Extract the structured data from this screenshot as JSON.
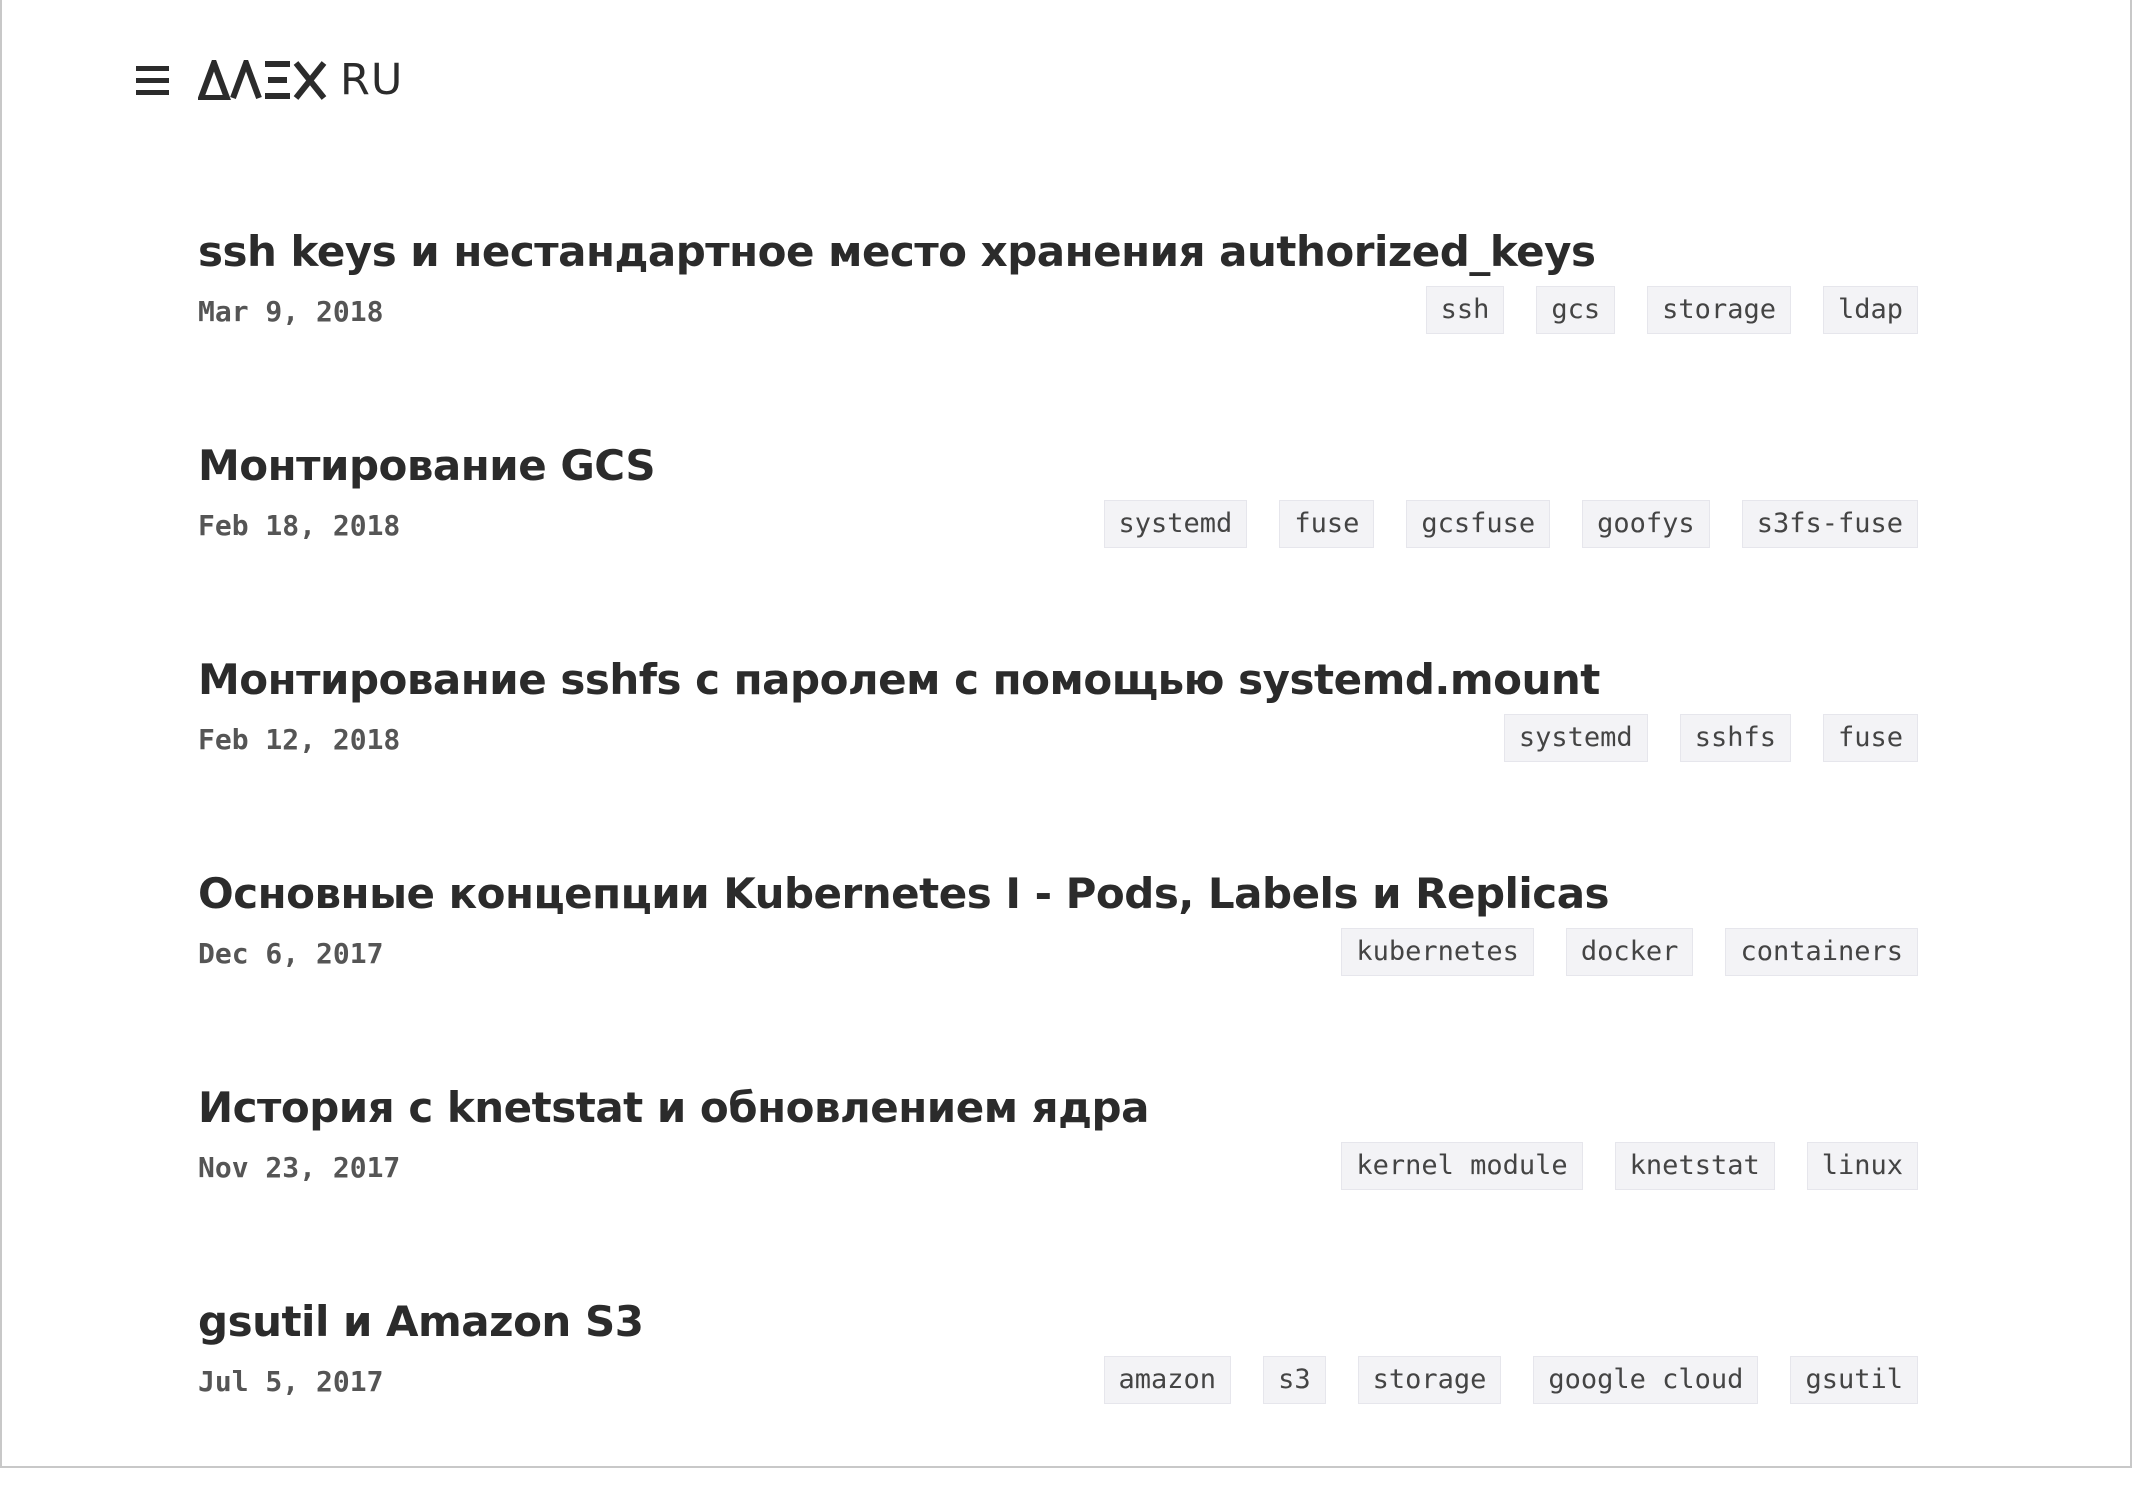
{
  "header": {
    "menu_icon": "hamburger-menu-icon",
    "logo_text": "ΔΛΞX",
    "logo_suffix": "RU"
  },
  "colors": {
    "text": "#2b2b2b",
    "date": "#555555",
    "tag_bg": "#f3f3f6",
    "tag_border": "#e6e6ec"
  },
  "posts": [
    {
      "title": "ssh keys и нестандартное место хранения authorized_keys",
      "date": "Mar 9, 2018",
      "tags": [
        "ssh",
        "gcs",
        "storage",
        "ldap"
      ]
    },
    {
      "title": "Монтирование GCS",
      "date": "Feb 18, 2018",
      "tags": [
        "systemd",
        "fuse",
        "gcsfuse",
        "goofys",
        "s3fs-fuse"
      ]
    },
    {
      "title": "Монтирование sshfs с паролем с помощью systemd.mount",
      "date": "Feb 12, 2018",
      "tags": [
        "systemd",
        "sshfs",
        "fuse"
      ]
    },
    {
      "title": "Основные концепции Kubernetes I - Pods, Labels и Replicas",
      "date": "Dec 6, 2017",
      "tags": [
        "kubernetes",
        "docker",
        "containers"
      ]
    },
    {
      "title": "История с knetstat и обновлением ядра",
      "date": "Nov 23, 2017",
      "tags": [
        "kernel module",
        "knetstat",
        "linux"
      ]
    },
    {
      "title": "gsutil и Amazon S3",
      "date": "Jul 5, 2017",
      "tags": [
        "amazon",
        "s3",
        "storage",
        "google cloud",
        "gsutil"
      ]
    }
  ]
}
